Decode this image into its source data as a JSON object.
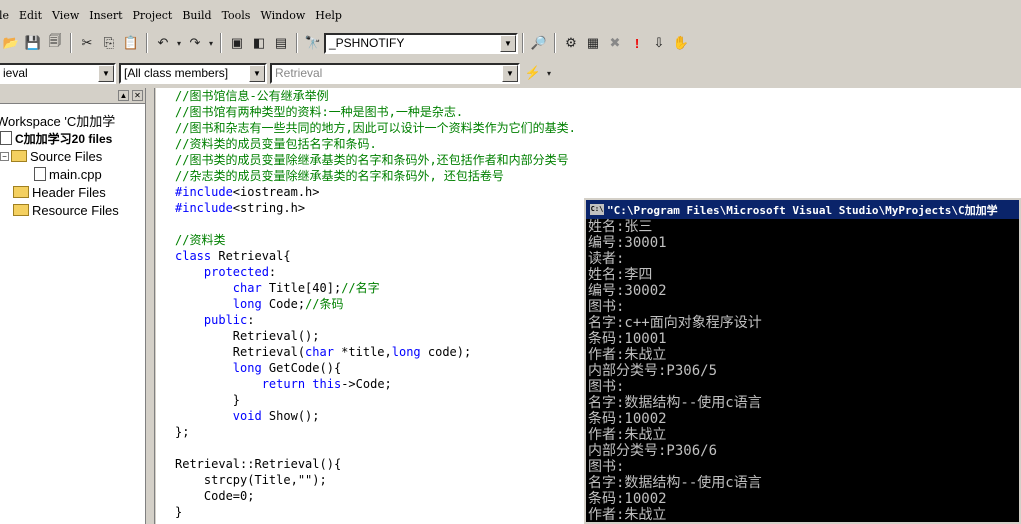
{
  "menu": [
    "le",
    "Edit",
    "View",
    "Insert",
    "Project",
    "Build",
    "Tools",
    "Window",
    "Help"
  ],
  "toolbar": {
    "symbol_combo": "_PSHNOTIFY"
  },
  "wizardbar": {
    "class_combo": "ieval",
    "filter_combo": "[All class members]",
    "member_combo": "Retrieval"
  },
  "workspace": {
    "root": "Workspace 'C加加学",
    "project": "C加加学习20 files",
    "source_files": "Source Files",
    "main_cpp": "main.cpp",
    "header_files": "Header Files",
    "resource_files": "Resource Files"
  },
  "code_lines": [
    {
      "t": "cm",
      "s": "//图书馆信息-公有继承举例"
    },
    {
      "t": "cm",
      "s": "//图书馆有两种类型的资料:一种是图书,一种是杂志."
    },
    {
      "t": "cm",
      "s": "//图书和杂志有一些共同的地方,因此可以设计一个资料类作为它们的基类."
    },
    {
      "t": "cm",
      "s": "//资料类的成员变量包括名字和条码."
    },
    {
      "t": "cm",
      "s": "//图书类的成员变量除继承基类的名字和条码外,还包括作者和内部分类号"
    },
    {
      "t": "cm",
      "s": "//杂志类的成员变量除继承基类的名字和条码外, 还包括卷号"
    },
    {
      "t": "pp",
      "s": "#include",
      "r": "<iostream.h>"
    },
    {
      "t": "pp",
      "s": "#include",
      "r": "<string.h>"
    },
    {
      "t": "plain",
      "s": ""
    },
    {
      "t": "cm",
      "s": "//资料类"
    },
    {
      "t": "kw",
      "s": "class",
      "r": " Retrieval{"
    },
    {
      "t": "kw",
      "s": "    protected",
      "r": ":"
    },
    {
      "t": "mix",
      "parts": [
        [
          "p",
          "        "
        ],
        [
          "k",
          "char"
        ],
        [
          "p",
          " Title[40];"
        ],
        [
          "c",
          "//名字"
        ]
      ]
    },
    {
      "t": "mix",
      "parts": [
        [
          "p",
          "        "
        ],
        [
          "k",
          "long"
        ],
        [
          "p",
          " Code;"
        ],
        [
          "c",
          "//条码"
        ]
      ]
    },
    {
      "t": "kw",
      "s": "    public",
      "r": ":"
    },
    {
      "t": "plain",
      "s": "        Retrieval();"
    },
    {
      "t": "mix",
      "parts": [
        [
          "p",
          "        Retrieval("
        ],
        [
          "k",
          "char"
        ],
        [
          "p",
          " *title,"
        ],
        [
          "k",
          "long"
        ],
        [
          "p",
          " code);"
        ]
      ]
    },
    {
      "t": "mix",
      "parts": [
        [
          "p",
          "        "
        ],
        [
          "k",
          "long"
        ],
        [
          "p",
          " GetCode(){"
        ]
      ]
    },
    {
      "t": "mix",
      "parts": [
        [
          "p",
          "            "
        ],
        [
          "k",
          "return"
        ],
        [
          "p",
          " "
        ],
        [
          "k",
          "this"
        ],
        [
          "p",
          "->Code;"
        ]
      ]
    },
    {
      "t": "plain",
      "s": "        }"
    },
    {
      "t": "mix",
      "parts": [
        [
          "p",
          "        "
        ],
        [
          "k",
          "void"
        ],
        [
          "p",
          " Show();"
        ]
      ]
    },
    {
      "t": "plain",
      "s": "};"
    },
    {
      "t": "plain",
      "s": ""
    },
    {
      "t": "plain",
      "s": "Retrieval::Retrieval(){"
    },
    {
      "t": "plain",
      "s": "    strcpy(Title,\"\");"
    },
    {
      "t": "plain",
      "s": "    Code=0;"
    },
    {
      "t": "plain",
      "s": "}"
    }
  ],
  "console": {
    "title": "\"C:\\Program Files\\Microsoft Visual Studio\\MyProjects\\C加加学",
    "lines": [
      "姓名:张三",
      "编号:30001",
      "读者:",
      "姓名:李四",
      "编号:30002",
      "图书:",
      "名字:c++面向对象程序设计",
      "条码:10001",
      "作者:朱战立",
      "内部分类号:P306/5",
      "图书:",
      "名字:数据结构--使用c语言",
      "条码:10002",
      "作者:朱战立",
      "内部分类号:P306/6",
      "图书:",
      "名字:数据结构--使用c语言",
      "条码:10002",
      "作者:朱战立"
    ]
  }
}
